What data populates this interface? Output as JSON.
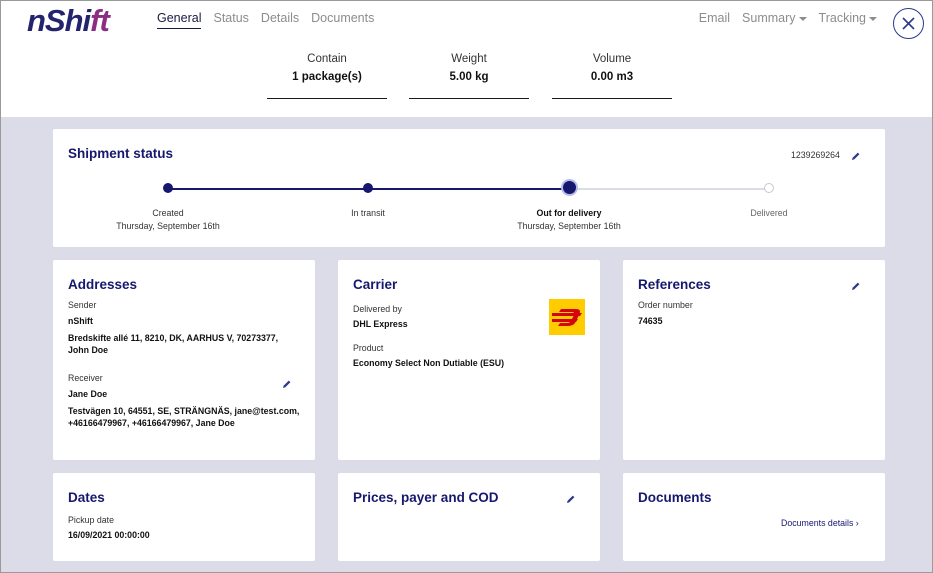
{
  "brand": {
    "logo_main": "nShi",
    "logo_accent": "ft",
    "color_primary": "#16186e",
    "color_accent": "#8a2d83"
  },
  "nav": {
    "tabs": [
      {
        "label": "General"
      },
      {
        "label": "Status"
      },
      {
        "label": "Details"
      },
      {
        "label": "Documents"
      }
    ],
    "active": "General"
  },
  "right_nav": {
    "email": "Email",
    "summary": "Summary",
    "tracking": "Tracking"
  },
  "summary_stats": [
    {
      "label": "Contain",
      "value": "1 package(s)"
    },
    {
      "label": "Weight",
      "value": "5.00 kg"
    },
    {
      "label": "Volume",
      "value": "0.00 m3"
    }
  ],
  "shipment_status": {
    "title": "Shipment status",
    "tracking_number": "1239269264",
    "steps": [
      {
        "label": "Created",
        "date": "Thursday, September 16th",
        "state": "done"
      },
      {
        "label": "In transit",
        "date": "",
        "state": "done"
      },
      {
        "label": "Out for delivery",
        "date": "Thursday, September 16th",
        "state": "current"
      },
      {
        "label": "Delivered",
        "date": "",
        "state": "pending"
      }
    ]
  },
  "addresses": {
    "title": "Addresses",
    "sender_label": "Sender",
    "sender_name": "nShift",
    "sender_address_line1": "Bredskifte allé 11, 8210, DK, AARHUS V, 70273377,",
    "sender_address_line2": "John Doe",
    "receiver_label": "Receiver",
    "receiver_name": "Jane Doe",
    "receiver_address_line1": "Testvägen 10, 64551, SE, STRÄNGNÄS, jane@test.com,",
    "receiver_address_line2": "+46166479967, +46166479967, Jane Doe"
  },
  "carrier": {
    "title": "Carrier",
    "delivered_by_label": "Delivered by",
    "delivered_by_value": "DHL Express",
    "product_label": "Product",
    "product_value": "Economy Select Non Dutiable (ESU)",
    "logo_color": "#ffcc00",
    "logo_mark_color": "#d40511"
  },
  "references": {
    "title": "References",
    "order_label": "Order number",
    "order_value": "74635"
  },
  "dates": {
    "title": "Dates",
    "pickup_label": "Pickup date",
    "pickup_value": "16/09/2021 00:00:00"
  },
  "prices": {
    "title": "Prices, payer and COD"
  },
  "documents": {
    "title": "Documents",
    "details_link": "Documents details ›"
  }
}
